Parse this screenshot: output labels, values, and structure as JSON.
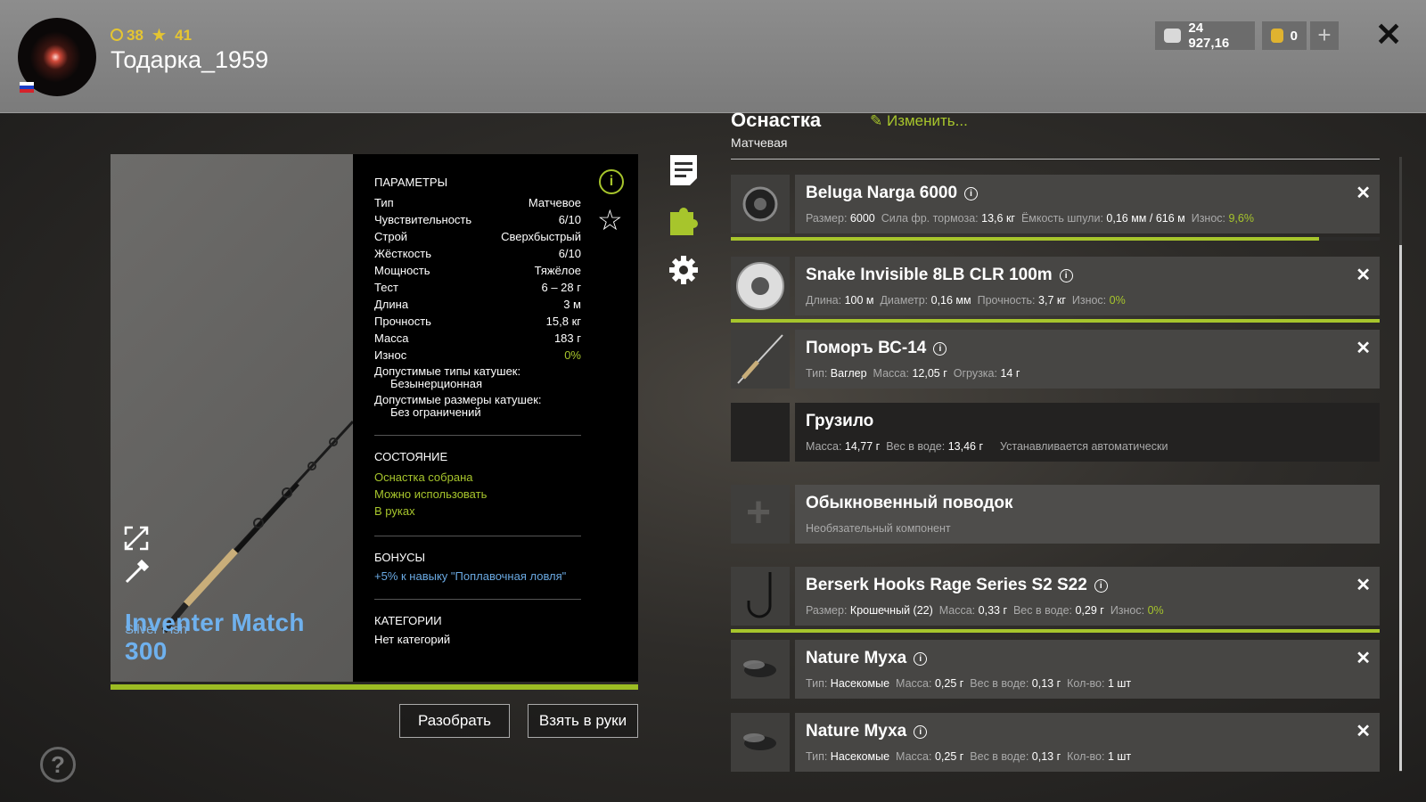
{
  "player": {
    "level": "38",
    "rating": "41",
    "name": "Тодарка_1959"
  },
  "currency": {
    "silver": "24 927,16",
    "gold": "0"
  },
  "rod": {
    "brand": "Silver Fish",
    "name": "Inventer Match 300"
  },
  "params": {
    "title": "ПАРАМЕТРЫ",
    "rows": [
      {
        "k": "Тип",
        "v": "Матчевое"
      },
      {
        "k": "Чувствительность",
        "v": "6/10"
      },
      {
        "k": "Строй",
        "v": "Сверхбыстрый"
      },
      {
        "k": "Жёсткость",
        "v": "6/10"
      },
      {
        "k": "Мощность",
        "v": "Тяжёлое"
      },
      {
        "k": "Тест",
        "v": "6 – 28 г"
      },
      {
        "k": "Длина",
        "v": "3 м"
      },
      {
        "k": "Прочность",
        "v": "15,8 кг"
      },
      {
        "k": "Масса",
        "v": "183 г"
      },
      {
        "k": "Износ",
        "v": "0%"
      }
    ],
    "reel_types_label": "Допустимые типы катушек:",
    "reel_types_value": "Безынерционная",
    "reel_sizes_label": "Допустимые размеры катушек:",
    "reel_sizes_value": "Без ограничений",
    "state_title": "СОСТОЯНИЕ",
    "state": [
      "Оснастка собрана",
      "Можно использовать",
      "В руках"
    ],
    "bonus_title": "БОНУСЫ",
    "bonus": "+5% к навыку \"Поплавочная ловля\"",
    "cat_title": "КАТЕГОРИИ",
    "cat": "Нет категорий"
  },
  "buttons": {
    "disassemble": "Разобрать",
    "take": "Взять в руки"
  },
  "tackle": {
    "title": "Оснастка",
    "subtitle": "Матчевая",
    "edit": "Изменить...",
    "items": [
      {
        "name": "Beluga Narga 6000",
        "specs": [
          [
            "Размер:",
            "6000"
          ],
          [
            "Сила фр. тормоза:",
            "13,6 кг"
          ],
          [
            "Ёмкость шпули:",
            "0,16 мм / 616 м"
          ],
          [
            "Износ:",
            "9,6%"
          ]
        ],
        "wear": 0.907
      },
      {
        "name": "Snake Invisible 8LB CLR 100m",
        "specs": [
          [
            "Длина:",
            "100 м"
          ],
          [
            "Диаметр:",
            "0,16 мм"
          ],
          [
            "Прочность:",
            "3,7 кг"
          ],
          [
            "Износ:",
            "0%"
          ]
        ],
        "wear": 1.0
      },
      {
        "name": "Поморъ ВС-14",
        "specs": [
          [
            "Тип:",
            "Ваглер"
          ],
          [
            "Масса:",
            "12,05 г"
          ],
          [
            "Огрузка:",
            "14 г"
          ]
        ]
      },
      {
        "name": "Грузило",
        "specs": [
          [
            "Масса:",
            "14,77 г"
          ],
          [
            "Вес в воде:",
            "13,46 г"
          ]
        ],
        "note": "Устанавливается автоматически"
      },
      {
        "name": "Обыкновенный поводок",
        "note": "Необязательный компонент"
      },
      {
        "name": "Berserk Hooks Rage Series S2 S22",
        "specs": [
          [
            "Размер:",
            "Крошечный (22)"
          ],
          [
            "Масса:",
            "0,33 г"
          ],
          [
            "Вес в воде:",
            "0,29 г"
          ],
          [
            "Износ:",
            "0%"
          ]
        ],
        "wear": 1.0
      },
      {
        "name": "Nature Муха",
        "specs": [
          [
            "Тип:",
            "Насекомые"
          ],
          [
            "Масса:",
            "0,25 г"
          ],
          [
            "Вес в воде:",
            "0,13 г"
          ],
          [
            "Кол-во:",
            "1 шт"
          ]
        ]
      },
      {
        "name": "Nature Муха",
        "specs": [
          [
            "Тип:",
            "Насекомые"
          ],
          [
            "Масса:",
            "0,25 г"
          ],
          [
            "Вес в воде:",
            "0,13 г"
          ],
          [
            "Кол-во:",
            "1 шт"
          ]
        ]
      }
    ]
  }
}
